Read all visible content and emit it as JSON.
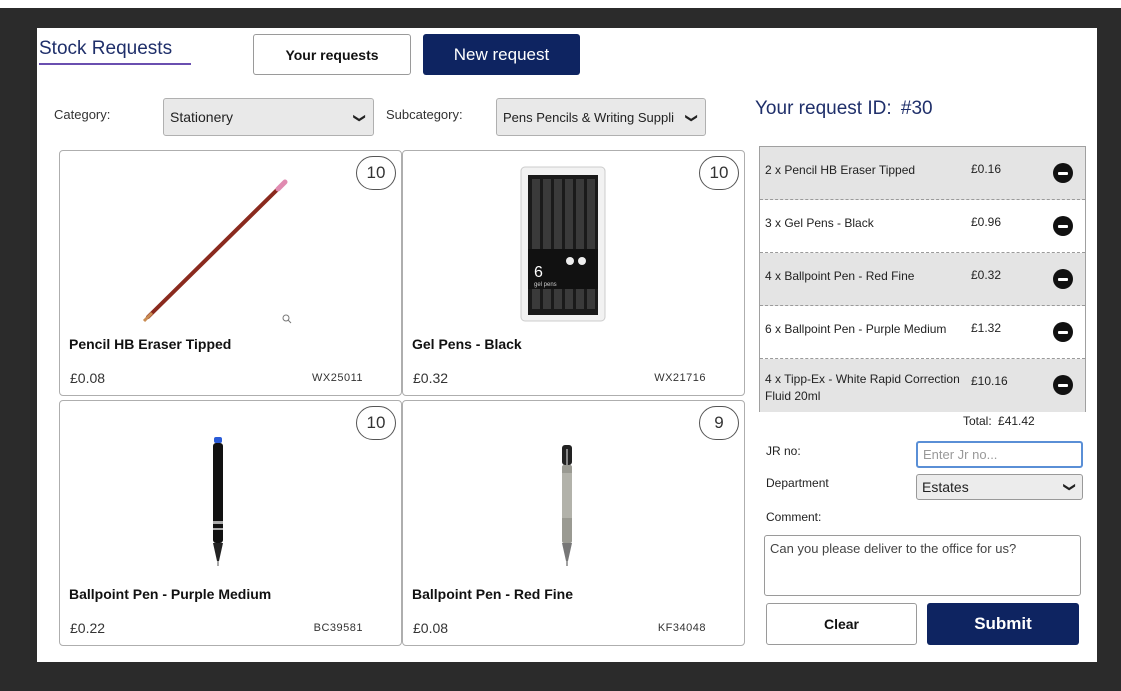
{
  "page": {
    "title": "Stock Requests"
  },
  "header": {
    "your_requests_label": "Your requests",
    "new_request_label": "New request"
  },
  "filters": {
    "category_label": "Category:",
    "category_value": "Stationery",
    "subcategory_label": "Subcategory:",
    "subcategory_value": "Pens Pencils & Writing Suppli"
  },
  "products": [
    {
      "name": "Pencil HB Eraser Tipped",
      "price": "£0.08",
      "code": "WX25011",
      "stock": "10",
      "icon": "pencil-image"
    },
    {
      "name": "Gel Pens - Black",
      "price": "£0.32",
      "code": "WX21716",
      "stock": "10",
      "icon": "gel-pens-pack-image"
    },
    {
      "name": "Ballpoint Pen - Purple Medium",
      "price": "£0.22",
      "code": "BC39581",
      "stock": "10",
      "icon": "black-pen-image"
    },
    {
      "name": "Ballpoint Pen - Red Fine",
      "price": "£0.08",
      "code": "KF34048",
      "stock": "9",
      "icon": "silver-pen-image"
    }
  ],
  "request": {
    "id_label": "Your request ID:",
    "id_value": "#30",
    "items": [
      {
        "desc": "2 x Pencil HB Eraser Tipped",
        "amount": "£0.16"
      },
      {
        "desc": "3 x Gel Pens - Black",
        "amount": "£0.96"
      },
      {
        "desc": "4 x Ballpoint Pen - Red Fine",
        "amount": "£0.32"
      },
      {
        "desc": "6 x Ballpoint Pen - Purple Medium",
        "amount": "£1.32"
      },
      {
        "desc": "4 x Tipp-Ex - White Rapid Correction Fluid 20ml",
        "amount": "£10.16"
      }
    ],
    "total_label": "Total:",
    "total_value": "£41.42"
  },
  "form": {
    "jr_label": "JR no:",
    "jr_placeholder": "Enter Jr no...",
    "jr_value": "",
    "department_label": "Department",
    "department_value": "Estates",
    "comment_label": "Comment:",
    "comment_value": "Can you please deliver to the office for us?",
    "clear_label": "Clear",
    "submit_label": "Submit"
  },
  "colors": {
    "brand_navy": "#0e2461",
    "title_text": "#1f2f6a",
    "accent_underline": "#6a4fb0",
    "focus_border": "#5a8fd6"
  }
}
